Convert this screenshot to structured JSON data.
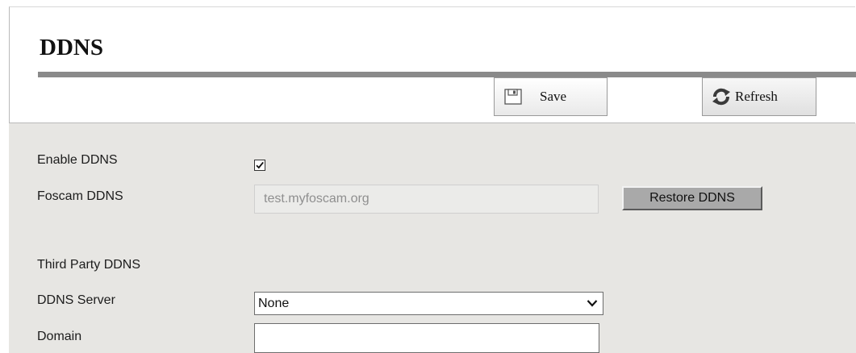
{
  "header": {
    "title": "DDNS",
    "save_label": "Save",
    "refresh_label": "Refresh"
  },
  "form": {
    "enable_ddns": {
      "label": "Enable DDNS",
      "checked": true
    },
    "foscam_ddns": {
      "label": "Foscam DDNS",
      "value": "test.myfoscam.org",
      "restore_label": "Restore DDNS"
    },
    "third_party_heading": "Third Party DDNS",
    "ddns_server": {
      "label": "DDNS Server",
      "selected": "None"
    },
    "domain": {
      "label": "Domain",
      "value": ""
    }
  },
  "icons": {
    "save": "save-icon",
    "refresh": "refresh-icon",
    "checkmark": "checkmark-icon",
    "dropdown": "chevron-down-icon"
  },
  "colors": {
    "content_background": "#e7e6e3",
    "title_rule": "#8a8a8a",
    "restore_button": "#a9a9a9",
    "disabled_field_text": "#8f8f8f"
  }
}
